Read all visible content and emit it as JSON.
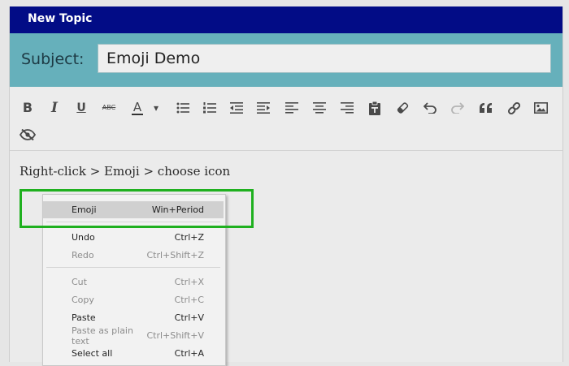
{
  "window": {
    "title": "New Topic"
  },
  "subject": {
    "label": "Subject:",
    "value": "Emoji Demo"
  },
  "toolbar": {
    "buttons": [
      {
        "name": "bold-icon",
        "glyph": "B"
      },
      {
        "name": "italic-icon",
        "glyph": "I"
      },
      {
        "name": "underline-icon",
        "glyph": "U"
      },
      {
        "name": "strikethrough-icon",
        "glyph": "ABC"
      },
      {
        "name": "font-color-icon",
        "glyph": "A"
      },
      {
        "name": "font-color-dropdown-icon",
        "glyph": "▾"
      },
      {
        "name": "bulleted-list-icon"
      },
      {
        "name": "numbered-list-icon"
      },
      {
        "name": "outdent-icon"
      },
      {
        "name": "indent-icon"
      },
      {
        "name": "align-left-icon"
      },
      {
        "name": "align-center-icon"
      },
      {
        "name": "align-right-icon"
      },
      {
        "name": "paste-icon"
      },
      {
        "name": "eraser-icon"
      },
      {
        "name": "undo-icon"
      },
      {
        "name": "redo-icon"
      },
      {
        "name": "quote-icon"
      },
      {
        "name": "link-icon"
      },
      {
        "name": "image-icon"
      },
      {
        "name": "eye-slash-icon"
      }
    ]
  },
  "editor": {
    "text": "Right-click > Emoji > choose icon"
  },
  "context_menu": {
    "items": [
      {
        "label": "Emoji",
        "shortcut": "Win+Period",
        "enabled": true,
        "highlighted": true
      },
      {
        "label": "Undo",
        "shortcut": "Ctrl+Z",
        "enabled": true
      },
      {
        "label": "Redo",
        "shortcut": "Ctrl+Shift+Z",
        "enabled": false
      },
      {
        "label": "Cut",
        "shortcut": "Ctrl+X",
        "enabled": false
      },
      {
        "label": "Copy",
        "shortcut": "Ctrl+C",
        "enabled": false
      },
      {
        "label": "Paste",
        "shortcut": "Ctrl+V",
        "enabled": true
      },
      {
        "label": "Paste as plain text",
        "shortcut": "Ctrl+Shift+V",
        "enabled": false
      },
      {
        "label": "Select all",
        "shortcut": "Ctrl+A",
        "enabled": true
      }
    ]
  },
  "colors": {
    "titlebar": "#020c86",
    "subject_band": "#66b0bb",
    "highlight_border": "#1fb01f"
  }
}
